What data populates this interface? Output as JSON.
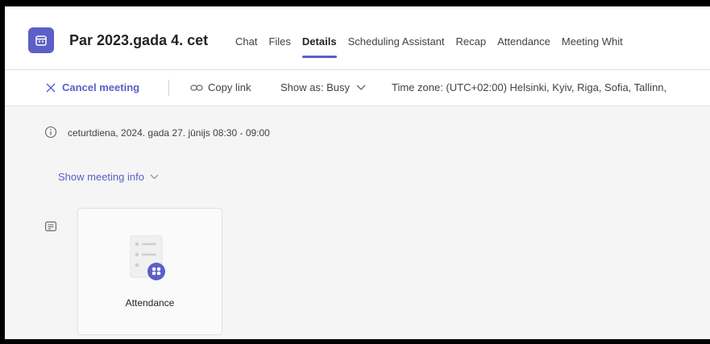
{
  "header": {
    "title": "Par 2023.gada 4. cet",
    "app_icon": "calendar-icon",
    "tabs": [
      {
        "label": "Chat",
        "active": false
      },
      {
        "label": "Files",
        "active": false
      },
      {
        "label": "Details",
        "active": true
      },
      {
        "label": "Scheduling Assistant",
        "active": false
      },
      {
        "label": "Recap",
        "active": false
      },
      {
        "label": "Attendance",
        "active": false
      },
      {
        "label": "Meeting Whit",
        "active": false
      }
    ]
  },
  "toolbar": {
    "cancel_label": "Cancel meeting",
    "copy_link_label": "Copy link",
    "show_as_label": "Show as: Busy",
    "timezone_label": "Time zone: (UTC+02:00) Helsinki, Kyiv, Riga, Sofia, Tallinn,"
  },
  "meeting": {
    "datetime": "ceturtdiena, 2024. gada 27. jūnijs 08:30 - 09:00",
    "show_info_label": "Show meeting info"
  },
  "attendance_card": {
    "label": "Attendance",
    "icon": "attendance-icon"
  },
  "colors": {
    "accent": "#5b5fc7",
    "background": "#f5f5f5",
    "text": "#242424"
  }
}
